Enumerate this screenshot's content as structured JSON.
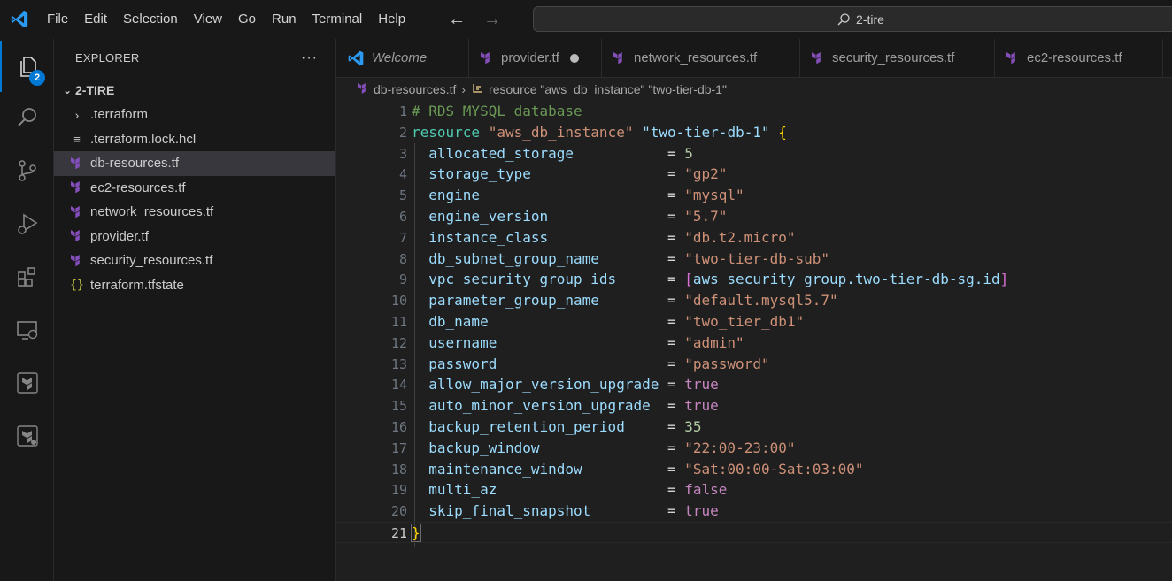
{
  "menu": [
    "File",
    "Edit",
    "Selection",
    "View",
    "Go",
    "Run",
    "Terminal",
    "Help"
  ],
  "command_center": {
    "text": "2-tire"
  },
  "activity_bar": {
    "explorer_badge": "2"
  },
  "sidebar": {
    "title": "EXPLORER",
    "folder": "2-TIRE",
    "items": [
      {
        "label": ".terraform",
        "type": "folder"
      },
      {
        "label": ".terraform.lock.hcl",
        "type": "lock"
      },
      {
        "label": "db-resources.tf",
        "type": "terraform",
        "selected": true
      },
      {
        "label": "ec2-resources.tf",
        "type": "terraform"
      },
      {
        "label": "network_resources.tf",
        "type": "terraform"
      },
      {
        "label": "provider.tf",
        "type": "terraform"
      },
      {
        "label": "security_resources.tf",
        "type": "terraform"
      },
      {
        "label": "terraform.tfstate",
        "type": "json"
      }
    ]
  },
  "tabs": [
    {
      "label": "Welcome",
      "icon": "vscode-icon",
      "italic": true
    },
    {
      "label": "provider.tf",
      "icon": "terraform-icon",
      "dirty": true
    },
    {
      "label": "network_resources.tf",
      "icon": "terraform-icon"
    },
    {
      "label": "security_resources.tf",
      "icon": "terraform-icon"
    },
    {
      "label": "ec2-resources.tf",
      "icon": "terraform-icon"
    }
  ],
  "breadcrumb": {
    "file": "db-resources.tf",
    "symbol": "resource \"aws_db_instance\" \"two-tier-db-1\""
  },
  "editor": {
    "current_line": 21,
    "comment": "# RDS MYSQL database",
    "resource_keyword": "resource",
    "resource_type": "\"aws_db_instance\"",
    "resource_name": "\"two-tier-db-1\"",
    "attributes": [
      {
        "key": "allocated_storage",
        "pad": "           ",
        "value": "5",
        "kind": "num"
      },
      {
        "key": "storage_type",
        "pad": "                ",
        "value": "\"gp2\"",
        "kind": "str"
      },
      {
        "key": "engine",
        "pad": "                      ",
        "value": "\"mysql\"",
        "kind": "str"
      },
      {
        "key": "engine_version",
        "pad": "              ",
        "value": "\"5.7\"",
        "kind": "str"
      },
      {
        "key": "instance_class",
        "pad": "              ",
        "value": "\"db.t2.micro\"",
        "kind": "str"
      },
      {
        "key": "db_subnet_group_name",
        "pad": "        ",
        "value": "\"two-tier-db-sub\"",
        "kind": "str"
      },
      {
        "key": "vpc_security_group_ids",
        "pad": "      ",
        "value": "aws_security_group.two-tier-db-sg.id",
        "kind": "list"
      },
      {
        "key": "parameter_group_name",
        "pad": "        ",
        "value": "\"default.mysql5.7\"",
        "kind": "str"
      },
      {
        "key": "db_name",
        "pad": "                     ",
        "value": "\"two_tier_db1\"",
        "kind": "str"
      },
      {
        "key": "username",
        "pad": "                    ",
        "value": "\"admin\"",
        "kind": "str"
      },
      {
        "key": "password",
        "pad": "                    ",
        "value": "\"password\"",
        "kind": "str"
      },
      {
        "key": "allow_major_version_upgrade",
        "pad": " ",
        "value": "true",
        "kind": "bool"
      },
      {
        "key": "auto_minor_version_upgrade",
        "pad": "  ",
        "value": "true",
        "kind": "bool"
      },
      {
        "key": "backup_retention_period",
        "pad": "     ",
        "value": "35",
        "kind": "num"
      },
      {
        "key": "backup_window",
        "pad": "               ",
        "value": "\"22:00-23:00\"",
        "kind": "str"
      },
      {
        "key": "maintenance_window",
        "pad": "          ",
        "value": "\"Sat:00:00-Sat:03:00\"",
        "kind": "str"
      },
      {
        "key": "multi_az",
        "pad": "                    ",
        "value": "false",
        "kind": "bool"
      },
      {
        "key": "skip_final_snapshot",
        "pad": "         ",
        "value": "true",
        "kind": "bool"
      }
    ]
  },
  "colors": {
    "accent": "#0078d4",
    "terraform": "#844fba",
    "comment": "#6a9955",
    "string": "#ce9178",
    "keyword": "#4ec9b0",
    "boolean": "#c586c0"
  }
}
